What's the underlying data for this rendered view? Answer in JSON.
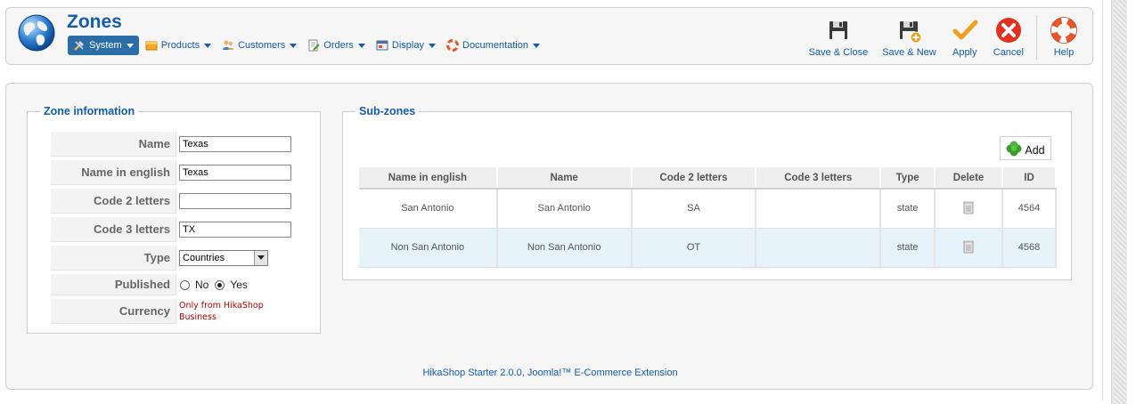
{
  "header": {
    "title": "Zones",
    "logo_icon": "globe-icon"
  },
  "menu": [
    {
      "label": "System",
      "icon": "system-tools-icon",
      "active": true
    },
    {
      "label": "Products",
      "icon": "products-icon",
      "active": false
    },
    {
      "label": "Customers",
      "icon": "customers-icon",
      "active": false
    },
    {
      "label": "Orders",
      "icon": "orders-icon",
      "active": false
    },
    {
      "label": "Display",
      "icon": "display-icon",
      "active": false
    },
    {
      "label": "Documentation",
      "icon": "lifebuoy-icon",
      "active": false
    }
  ],
  "toolbar": {
    "save_close": "Save & Close",
    "save_new": "Save & New",
    "apply": "Apply",
    "cancel": "Cancel",
    "help": "Help"
  },
  "zone_info": {
    "legend": "Zone information",
    "fields": {
      "name": {
        "label": "Name",
        "value": "Texas"
      },
      "name_english": {
        "label": "Name in english",
        "value": "Texas"
      },
      "code2": {
        "label": "Code 2 letters",
        "value": ""
      },
      "code3": {
        "label": "Code 3 letters",
        "value": "TX"
      },
      "type": {
        "label": "Type",
        "value": "Countries"
      },
      "published": {
        "label": "Published",
        "option_no": "No",
        "option_yes": "Yes",
        "selected": "Yes"
      },
      "currency": {
        "label": "Currency",
        "note": "Only from HikaShop Business"
      }
    }
  },
  "subzones": {
    "legend": "Sub-zones",
    "add_label": "Add",
    "columns": [
      "Name in english",
      "Name",
      "Code 2 letters",
      "Code 3 letters",
      "Type",
      "Delete",
      "ID"
    ],
    "rows": [
      {
        "name_english": "San Antonio",
        "name": "San Antonio",
        "code2": "SA",
        "code3": "",
        "type": "state",
        "id": "4564"
      },
      {
        "name_english": "Non San Antonio",
        "name": "Non San Antonio",
        "code2": "OT",
        "code3": "",
        "type": "state",
        "id": "4568"
      }
    ]
  },
  "footer": {
    "text": "HikaShop Starter 2.0.0, Joomla!™ E-Commerce Extension"
  },
  "colors": {
    "accent": "#135cae",
    "active_menu": "#2b6da6",
    "alt_row": "#e6f3fb",
    "note_red": "#b00000"
  }
}
